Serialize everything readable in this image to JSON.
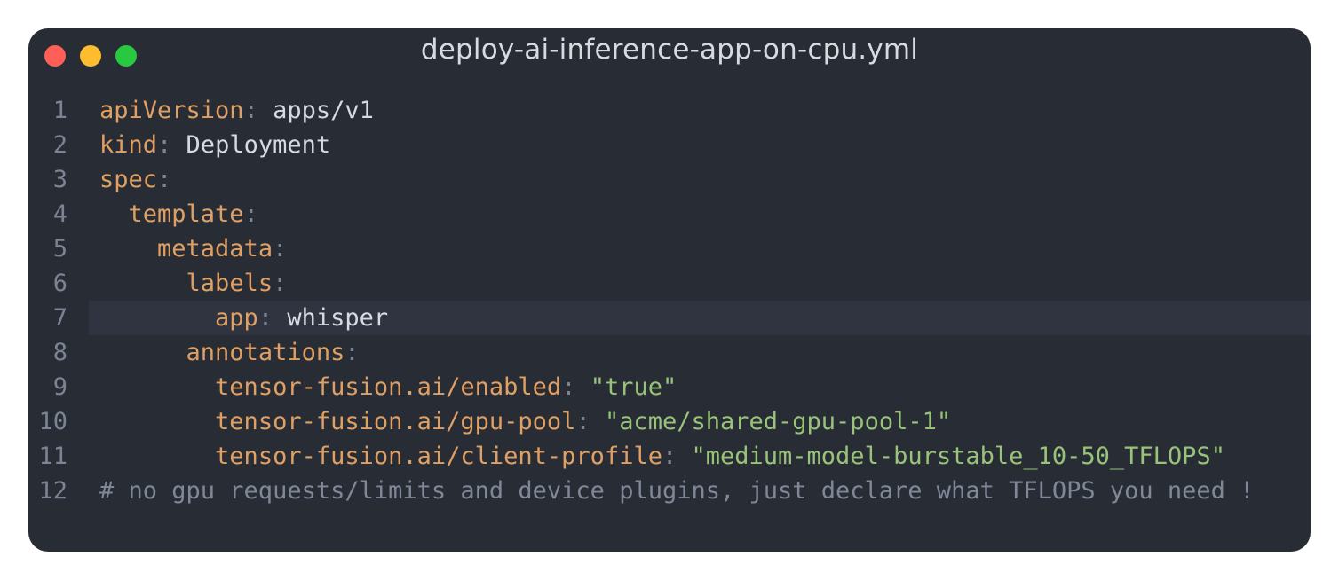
{
  "window": {
    "title": "deploy-ai-inference-app-on-cpu.yml",
    "colors": {
      "background": "#282c34",
      "close": "#ff5f57",
      "minimize": "#febc2e",
      "maximize": "#28c840",
      "key": "#e0a064",
      "string": "#98c379",
      "comment": "#7f8798"
    }
  },
  "editor": {
    "active_line": 7,
    "lines": [
      {
        "num": "1",
        "indent": "",
        "key": "apiVersion",
        "sep": ":",
        "value": " apps/v1",
        "string": "",
        "comment": ""
      },
      {
        "num": "2",
        "indent": "",
        "key": "kind",
        "sep": ":",
        "value": " Deployment",
        "string": "",
        "comment": ""
      },
      {
        "num": "3",
        "indent": "",
        "key": "spec",
        "sep": ":",
        "value": "",
        "string": "",
        "comment": ""
      },
      {
        "num": "4",
        "indent": "  ",
        "key": "template",
        "sep": ":",
        "value": "",
        "string": "",
        "comment": ""
      },
      {
        "num": "5",
        "indent": "    ",
        "key": "metadata",
        "sep": ":",
        "value": "",
        "string": "",
        "comment": ""
      },
      {
        "num": "6",
        "indent": "      ",
        "key": "labels",
        "sep": ":",
        "value": "",
        "string": "",
        "comment": ""
      },
      {
        "num": "7",
        "indent": "        ",
        "key": "app",
        "sep": ":",
        "value": " whisper",
        "string": "",
        "comment": ""
      },
      {
        "num": "8",
        "indent": "      ",
        "key": "annotations",
        "sep": ":",
        "value": "",
        "string": "",
        "comment": ""
      },
      {
        "num": "9",
        "indent": "        ",
        "key": "tensor-fusion.ai/enabled",
        "sep": ":",
        "value": " ",
        "string": "\"true\"",
        "comment": ""
      },
      {
        "num": "10",
        "indent": "        ",
        "key": "tensor-fusion.ai/gpu-pool",
        "sep": ":",
        "value": " ",
        "string": "\"acme/shared-gpu-pool-1\"",
        "comment": ""
      },
      {
        "num": "11",
        "indent": "        ",
        "key": "tensor-fusion.ai/client-profile",
        "sep": ":",
        "value": " ",
        "string": "\"medium-model-burstable_10-50_TFLOPS\"",
        "comment": ""
      },
      {
        "num": "12",
        "indent": "",
        "key": "",
        "sep": "",
        "value": "",
        "string": "",
        "comment": "# no gpu requests/limits and device plugins, just declare what TFLOPS you need !"
      }
    ]
  }
}
